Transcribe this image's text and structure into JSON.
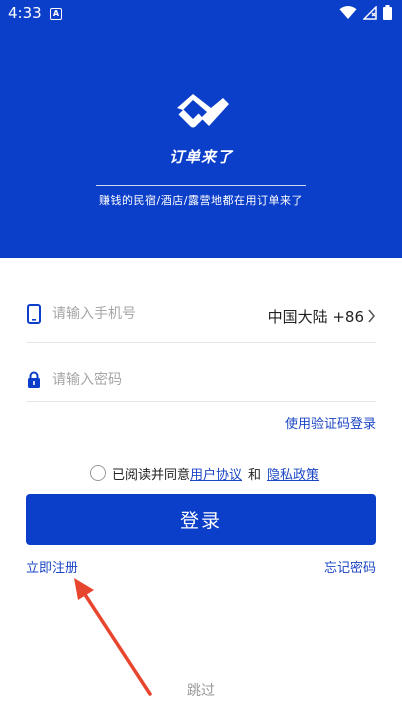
{
  "status_bar": {
    "time": "4:33",
    "notification_badge": "A",
    "icons": [
      "wifi-icon",
      "signal-no-sim-icon",
      "battery-icon"
    ]
  },
  "hero": {
    "app_name": "订单来了",
    "tagline": "赚钱的民宿/酒店/露营地都在用订单来了",
    "background_color": "#0b3ec9"
  },
  "phone_field": {
    "placeholder": "请输入手机号",
    "value": "",
    "region_label": "中国大陆 +86",
    "icon": "phone-icon"
  },
  "password_field": {
    "placeholder": "请输入密码",
    "value": "",
    "icon": "lock-icon"
  },
  "sms_login_label": "使用验证码登录",
  "agreement": {
    "prefix": "已阅读并同意",
    "user_agreement": "用户协议",
    "and": "和",
    "privacy_policy": "隐私政策",
    "checked": false
  },
  "login_button_label": "登录",
  "register_label": "立即注册",
  "forgot_password_label": "忘记密码",
  "skip_label": "跳过",
  "colors": {
    "brand_blue": "#0b3ec9",
    "link_blue": "#1b46c4",
    "annotation_red": "#e8452f"
  }
}
